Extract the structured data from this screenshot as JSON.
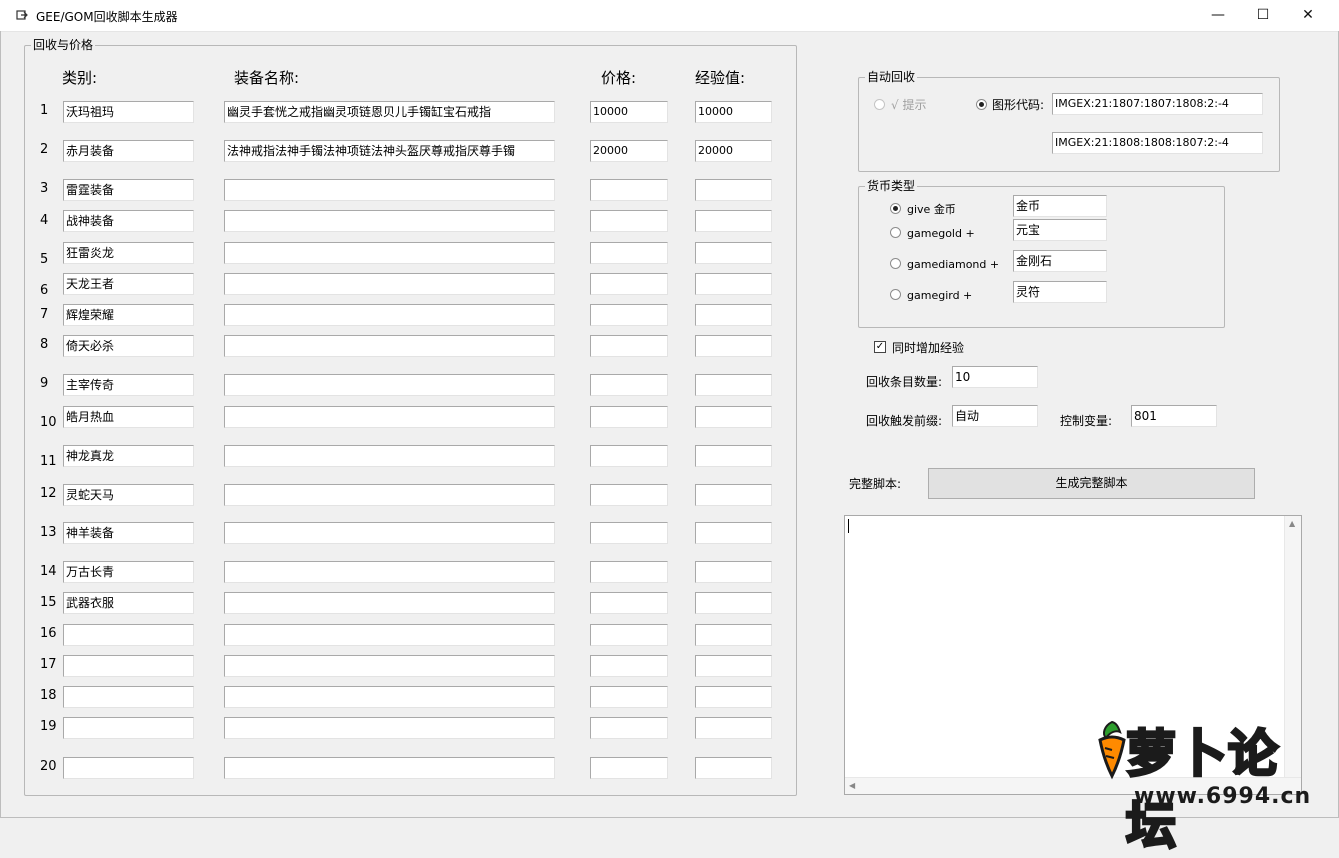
{
  "window": {
    "title": "GEE/GOM回收脚本生成器",
    "minimize": "—",
    "maximize": "☐",
    "close": "✕"
  },
  "recycle_group": {
    "label": "回收与价格",
    "headers": {
      "category": "类别:",
      "name": "装备名称:",
      "price": "价格:",
      "exp": "经验值:"
    },
    "rows": [
      {
        "num": "1",
        "category": "沃玛祖玛",
        "name": "幽灵手套恍之戒指幽灵项链恩贝儿手镯缸宝石戒指",
        "price": "10000",
        "exp": "10000"
      },
      {
        "num": "2",
        "category": "赤月装备",
        "name": "法神戒指法神手镯法神项链法神头盔厌尊戒指厌尊手镯",
        "price": "20000",
        "exp": "20000"
      },
      {
        "num": "3",
        "category": "雷霆装备",
        "name": "",
        "price": "",
        "exp": ""
      },
      {
        "num": "4",
        "category": "战神装备",
        "name": "",
        "price": "",
        "exp": ""
      },
      {
        "num": "5",
        "category": "狂雷炎龙",
        "name": "",
        "price": "",
        "exp": ""
      },
      {
        "num": "6",
        "category": "天龙王者",
        "name": "",
        "price": "",
        "exp": ""
      },
      {
        "num": "7",
        "category": "辉煌荣耀",
        "name": "",
        "price": "",
        "exp": ""
      },
      {
        "num": "8",
        "category": "倚天必杀",
        "name": "",
        "price": "",
        "exp": ""
      },
      {
        "num": "9",
        "category": "主宰传奇",
        "name": "",
        "price": "",
        "exp": ""
      },
      {
        "num": "10",
        "category": "皓月热血",
        "name": "",
        "price": "",
        "exp": ""
      },
      {
        "num": "11",
        "category": "神龙真龙",
        "name": "",
        "price": "",
        "exp": ""
      },
      {
        "num": "12",
        "category": "灵蛇天马",
        "name": "",
        "price": "",
        "exp": ""
      },
      {
        "num": "13",
        "category": "神羊装备",
        "name": "",
        "price": "",
        "exp": ""
      },
      {
        "num": "14",
        "category": "万古长青",
        "name": "",
        "price": "",
        "exp": ""
      },
      {
        "num": "15",
        "category": "武器衣服",
        "name": "",
        "price": "",
        "exp": ""
      },
      {
        "num": "16",
        "category": "",
        "name": "",
        "price": "",
        "exp": ""
      },
      {
        "num": "17",
        "category": "",
        "name": "",
        "price": "",
        "exp": ""
      },
      {
        "num": "18",
        "category": "",
        "name": "",
        "price": "",
        "exp": ""
      },
      {
        "num": "19",
        "category": "",
        "name": "",
        "price": "",
        "exp": ""
      },
      {
        "num": "20",
        "category": "",
        "name": "",
        "price": "",
        "exp": ""
      }
    ]
  },
  "auto_recycle": {
    "label": "自动回收",
    "option_hint": "√ 提示",
    "option_graphic": "图形代码:",
    "code1": "IMGEX:21:1807:1807:1808:2:-4",
    "code2": "IMGEX:21:1808:1808:1807:2:-4"
  },
  "currency": {
    "label": "货币类型",
    "options": [
      {
        "label": "give 金币",
        "value": "金币",
        "selected": true
      },
      {
        "label": "gamegold +",
        "value": "元宝",
        "selected": false
      },
      {
        "label": "gamediamond +",
        "value": "金刚石",
        "selected": false
      },
      {
        "label": "gamegird +",
        "value": "灵符",
        "selected": false
      }
    ]
  },
  "settings": {
    "add_exp_label": "同时增加经验",
    "add_exp_checked": true,
    "count_label": "回收条目数量:",
    "count_value": "10",
    "prefix_label": "回收触发前缀:",
    "prefix_value": "自动",
    "var_label": "控制变量:",
    "var_value": "801"
  },
  "script": {
    "label": "完整脚本:",
    "generate_button": "生成完整脚本",
    "content": ""
  },
  "watermark": {
    "logo_text": "萝卜论坛",
    "url": "www.6994.cn"
  }
}
